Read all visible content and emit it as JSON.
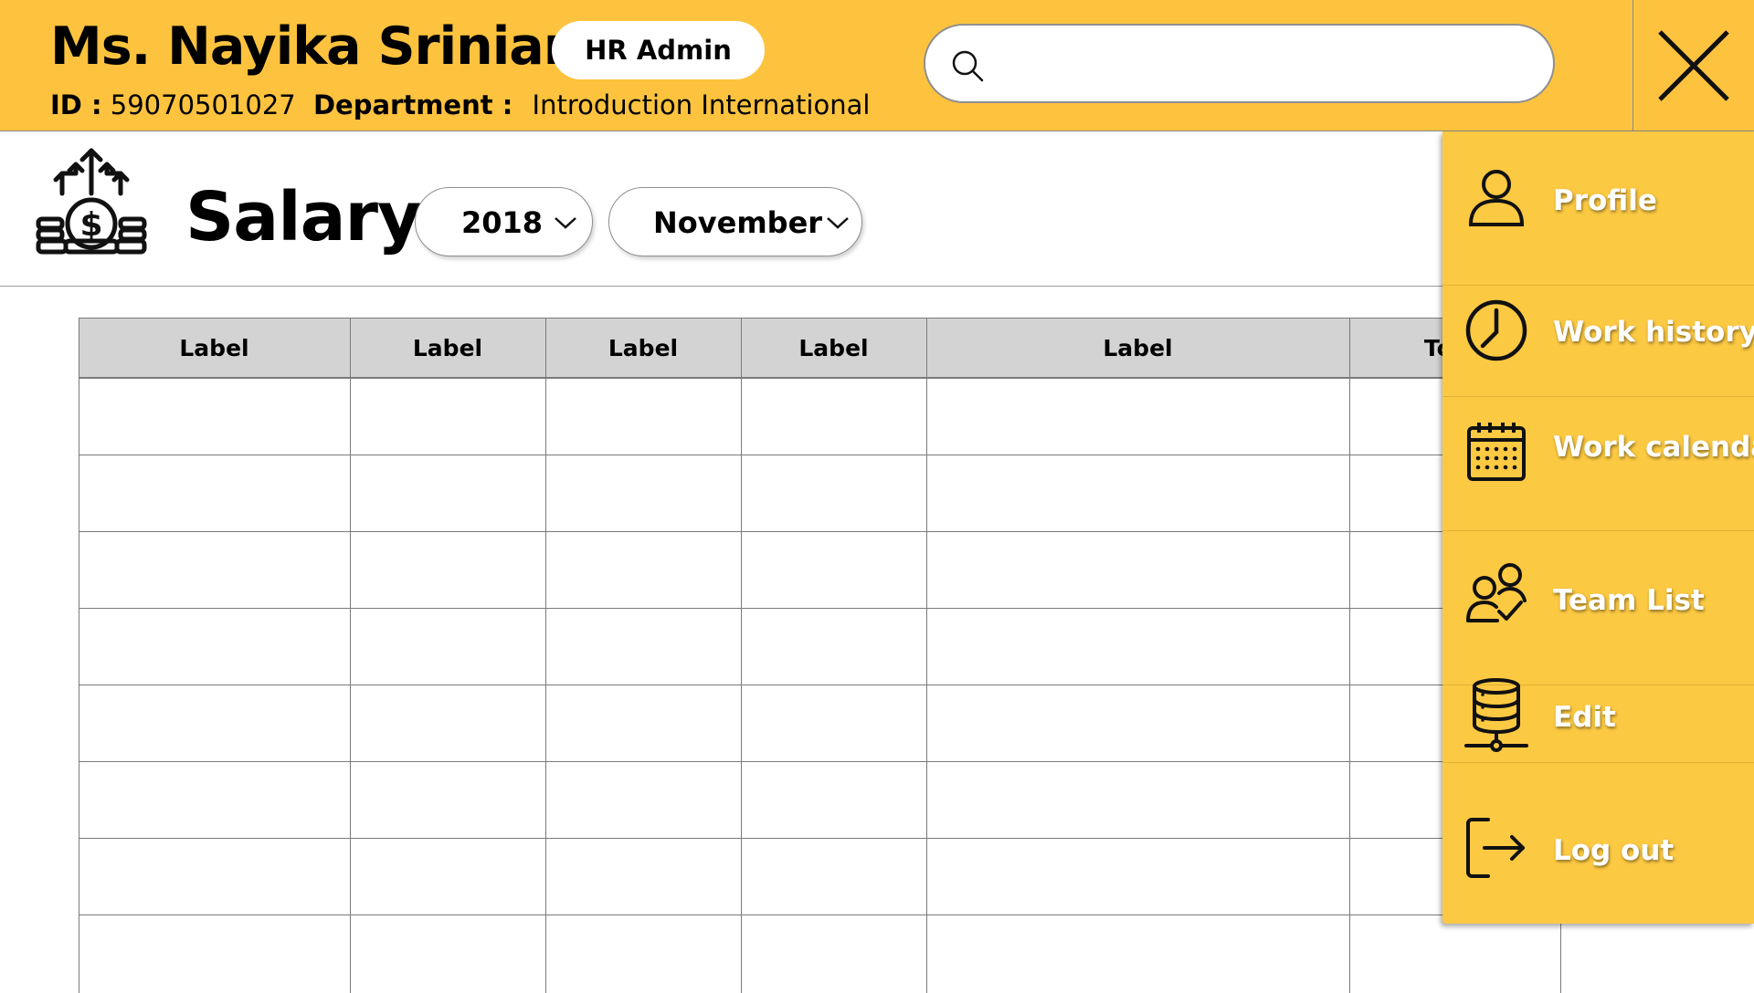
{
  "header": {
    "user_name": "Ms. Nayika Srinian",
    "role_badge": "HR Admin",
    "id_label": "ID :",
    "id_value": "59070501027",
    "department_label": "Department :",
    "department_value": "Introduction International",
    "search_placeholder": "",
    "search_icon": "search-icon",
    "close_icon": "close-icon"
  },
  "salary": {
    "title": "Salary",
    "icon": "money-growth-icon",
    "year": "2018",
    "month": "November"
  },
  "table": {
    "columns": [
      "Label",
      "Label",
      "Label",
      "Label",
      "Label",
      "Total"
    ],
    "rows": [
      [
        "",
        "",
        "",
        "",
        "",
        ""
      ],
      [
        "",
        "",
        "",
        "",
        "",
        ""
      ],
      [
        "",
        "",
        "",
        "",
        "",
        ""
      ],
      [
        "",
        "",
        "",
        "",
        "",
        ""
      ],
      [
        "",
        "",
        "",
        "",
        "",
        ""
      ],
      [
        "",
        "",
        "",
        "",
        "",
        ""
      ],
      [
        "",
        "",
        "",
        "",
        "",
        ""
      ],
      [
        "",
        "",
        "",
        "",
        "",
        ""
      ]
    ]
  },
  "side_menu": {
    "items": [
      {
        "label": "Profile",
        "icon": "user-icon"
      },
      {
        "label": "Work history",
        "icon": "clock-icon"
      },
      {
        "label": "Work calendar",
        "icon": "calendar-icon"
      },
      {
        "label": "Team List",
        "icon": "team-icon"
      },
      {
        "label": "Edit",
        "icon": "database-icon"
      },
      {
        "label": "Log out",
        "icon": "logout-icon"
      }
    ]
  },
  "colors": {
    "accent": "#fdc33e",
    "menu_background": "#fcc942",
    "table_header": "#d3d3d3"
  }
}
